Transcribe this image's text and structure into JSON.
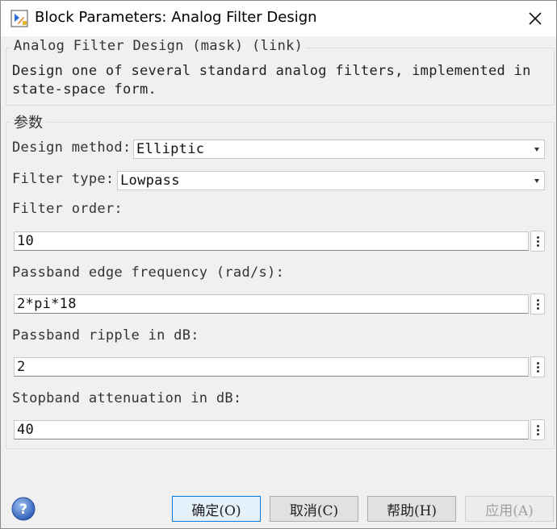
{
  "window": {
    "title": "Block Parameters: Analog Filter Design",
    "close_icon": "close-icon"
  },
  "description_group": {
    "legend": "Analog Filter Design (mask) (link)",
    "line1": "Design one of several standard analog filters, implemented in",
    "line2": "state-space form."
  },
  "params": {
    "legend": "参数",
    "design_method": {
      "label": "Design method:",
      "value": "Elliptic"
    },
    "filter_type": {
      "label": "Filter type:",
      "value": "Lowpass"
    },
    "filter_order": {
      "label": "Filter order:",
      "value": "10"
    },
    "passband_edge": {
      "label": "Passband edge frequency (rad/s):",
      "value": "2*pi*18"
    },
    "passband_ripple": {
      "label": "Passband ripple in dB:",
      "value": "2"
    },
    "stopband_atten": {
      "label": "Stopband attenuation in dB:",
      "value": "40"
    }
  },
  "buttons": {
    "ok": "确定(O)",
    "cancel": "取消(C)",
    "help": "帮助(H)",
    "apply": "应用(A)"
  },
  "colors": {
    "accent": "#0078d7",
    "help_icon": "#3c6fc4"
  }
}
